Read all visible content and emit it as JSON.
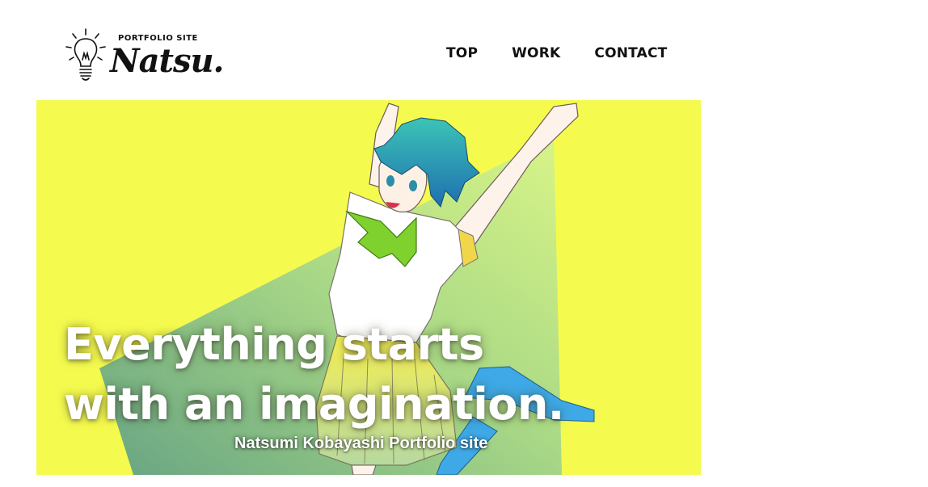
{
  "logo": {
    "subtitle": "PORTFOLIO SITE",
    "name": "Natsu.",
    "icon": "lightbulb-icon"
  },
  "nav": {
    "items": [
      {
        "label": "TOP"
      },
      {
        "label": "WORK"
      },
      {
        "label": "CONTACT"
      }
    ]
  },
  "hero": {
    "title_line1": "Everything starts",
    "title_line2": "with an imagination.",
    "subtitle": "Natsumi Kobayashi Portfolio site",
    "colors": {
      "background": "#f5fb4e",
      "triangle_dark": "#5f9f86",
      "triangle_light": "#cdf08a",
      "hair": "#2aa3b8",
      "tie": "#7fd12e",
      "skirt": "#f1e84a",
      "socks": "#3ea9e6"
    }
  }
}
